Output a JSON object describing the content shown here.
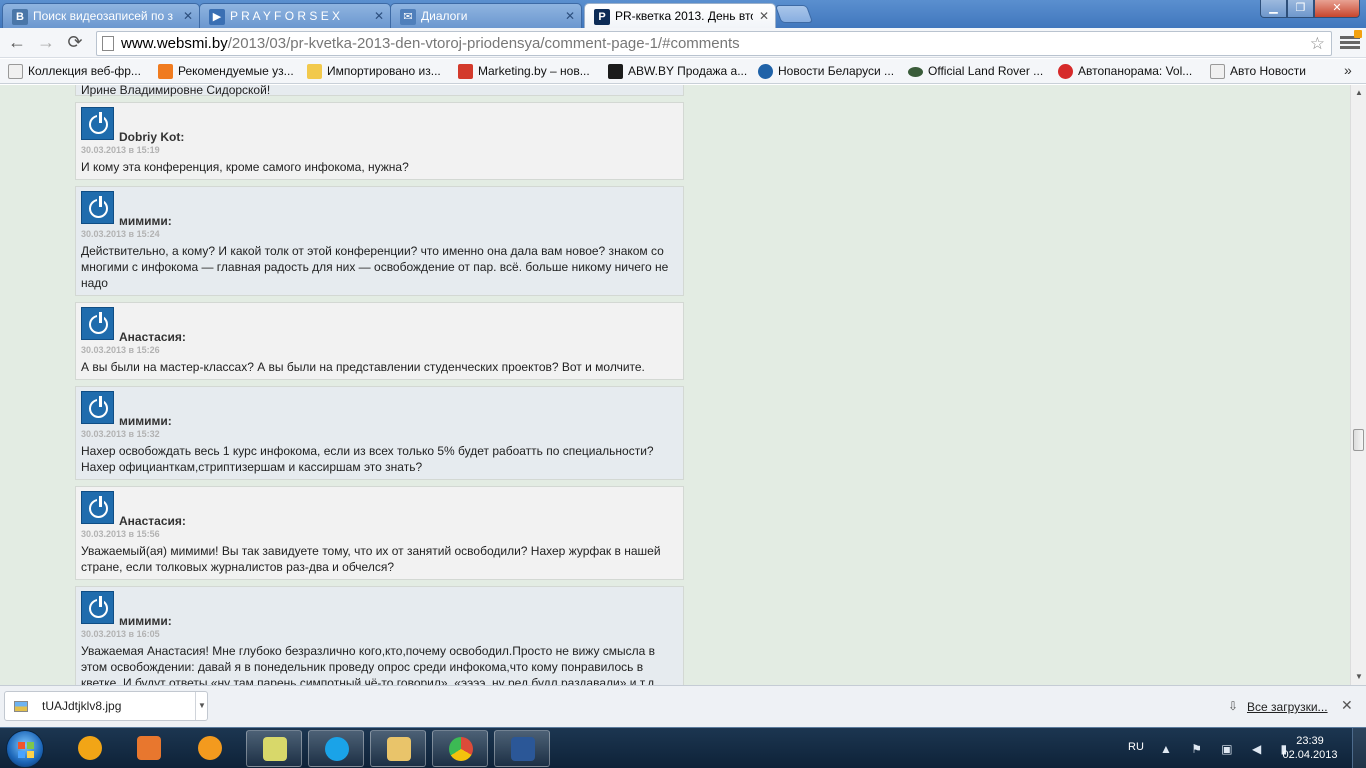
{
  "tabs": [
    {
      "label": "Поиск видеозаписей по з",
      "icon": "vk-icon",
      "color": "#4a76a8",
      "glyph": "B"
    },
    {
      "label": "P R A Y F O R S E X",
      "icon": "play-icon",
      "color": "#3a6fb3",
      "glyph": "▶"
    },
    {
      "label": "Диалоги",
      "icon": "chat-icon",
      "color": "#4f7fbb",
      "glyph": "✉"
    },
    {
      "label": "PR-кветка 2013. День втор",
      "icon": "site-icon",
      "color": "#0d2c56",
      "glyph": "P"
    }
  ],
  "toolbar": {
    "back": "←",
    "forward": "→",
    "reload": "⟳",
    "url_host": "www.websmi.by",
    "url_path": "/2013/03/pr-kvetka-2013-den-vtoroj-priodensya/comment-page-1/#comments",
    "star": "☆"
  },
  "bookmarks": [
    {
      "label": "Коллекция веб-фр...",
      "color": "#f0f0f0"
    },
    {
      "label": "Рекомендуемые уз...",
      "color": "#f07b1f"
    },
    {
      "label": "Импортировано из...",
      "color": "#f2c94c"
    },
    {
      "label": "Marketing.by – нов...",
      "color": "#d33a2c"
    },
    {
      "label": "ABW.BY Продажа а...",
      "color": "#1b1b1b"
    },
    {
      "label": "Новости Беларуси ...",
      "color": "#1f62a8"
    },
    {
      "label": "Official Land Rover ...",
      "color": "#3a5c3a"
    },
    {
      "label": "Автопанорама: Vol...",
      "color": "#d62a2a"
    },
    {
      "label": "Авто Новости",
      "color": "#f0f0f0"
    }
  ],
  "bookmarks_more": "»",
  "partial_comment_text": "Ирине Владимировне Сидорской!",
  "comments": [
    {
      "author": "Dobriy Kot:",
      "date": "30.03.2013 в 15:19",
      "text": "И кому эта конференция, кроме самого инфокома, нужна?"
    },
    {
      "author": "мимими:",
      "date": "30.03.2013 в 15:24",
      "text": "Действительно, а кому? И какой толк от этой конференции? что именно она дала вам новое? знаком со многими с инфокома — главная радость для них — освобождение от пар. всё. больше никому ничего не надо"
    },
    {
      "author": "Анастасия:",
      "date": "30.03.2013 в 15:26",
      "text": "А вы были на мастер-классах? А вы были на представлении студенческих проектов? Вот и молчите."
    },
    {
      "author": "мимими:",
      "date": "30.03.2013 в 15:32",
      "text": "Нахер освобождать весь 1 курс инфокома, если из всех только 5% будет рабоатть по специальности? Нахер официанткам,стриптизершам и кассиршам это знать?"
    },
    {
      "author": "Анастасия:",
      "date": "30.03.2013 в 15:56",
      "text": "Уважаемый(ая) мимими! Вы так завидуете тому, что их от занятий освободили? Нахер журфак в нашей стране, если толковых журналистов раз-два и обчелся?"
    },
    {
      "author": "мимими:",
      "date": "30.03.2013 в 16:05",
      "text": "Уважаемая Анастасия! Мне глубоко безразлично кого,кто,почему освободил.Просто не вижу смысла в этом освобождении: давай я в понедельник проведу опрос среди инфокома,что кому понравилось в кветке. И будут ответы «ну там парень симпотный чё-то говорил», «ээээ. ну ред будл раздавали» и т.д."
    }
  ],
  "download": {
    "filename": "tUAJdtjklv8.jpg",
    "show_all": "Все загрузки...",
    "close": "✕"
  },
  "taskbar": {
    "apps": [
      {
        "name": "aimp-icon",
        "color": "#f2a516",
        "pinned": false
      },
      {
        "name": "media-player-icon",
        "color": "#e8772e",
        "pinned": false
      },
      {
        "name": "odnoklassniki-icon",
        "color": "#f39a1e",
        "pinned": false
      },
      {
        "name": "sticky-notes-icon",
        "color": "#d8d86a",
        "pinned": true
      },
      {
        "name": "skype-icon",
        "color": "#1aa3e8",
        "pinned": true
      },
      {
        "name": "explorer-icon",
        "color": "#e9c46a",
        "pinned": true
      },
      {
        "name": "chrome-icon",
        "color": "#dd4b39",
        "pinned": true
      },
      {
        "name": "word-icon",
        "color": "#2b5797",
        "pinned": true
      }
    ],
    "lang": "RU",
    "time": "23:39",
    "date": "02.04.2013"
  }
}
